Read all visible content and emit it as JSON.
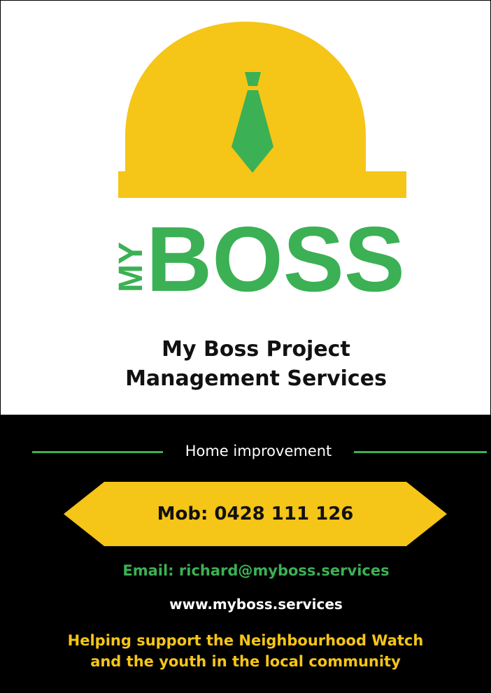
{
  "logo": {
    "my_text": "MY",
    "boss_text": "BOSS",
    "icon": "hard-hat-with-tie-icon",
    "colors": {
      "yellow": "#f5c518",
      "green": "#3cb054"
    }
  },
  "company_name": {
    "line1": "My Boss Project",
    "line2": "Management Services"
  },
  "subtitle": "Home improvement",
  "contact": {
    "mobile": "Mob: 0428 111 126",
    "email": "Email: richard@myboss.services",
    "website": "www.myboss.services"
  },
  "tagline": {
    "line1": "Helping support the Neighbourhood Watch",
    "line2": "and the youth in the local community"
  },
  "colors": {
    "background_dark": "#000000",
    "accent_yellow": "#f5c518",
    "accent_green": "#3cb054",
    "text_dark": "#111111",
    "text_light": "#ffffff"
  }
}
